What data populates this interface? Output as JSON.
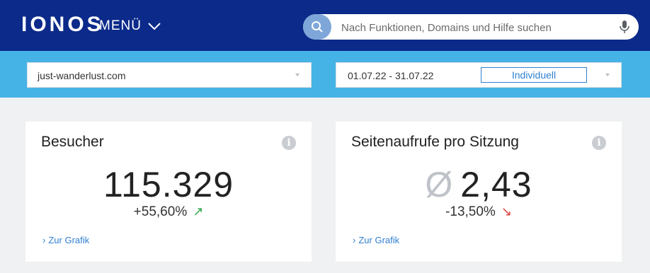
{
  "header": {
    "logo": "IONOS",
    "menu_label": "MENÜ",
    "search_placeholder": "Nach Funktionen, Domains und Hilfe suchen"
  },
  "filters": {
    "domain": "just-wanderlust.com",
    "date_range": "01.07.22 - 31.07.22",
    "range_type": "Individuell"
  },
  "cards": [
    {
      "title": "Besucher",
      "avg_symbol": "",
      "value": "115.329",
      "change": "+55,60%",
      "trend": "up",
      "link": "Zur Grafik"
    },
    {
      "title": "Seitenaufrufe pro Sitzung",
      "avg_symbol": "Ø",
      "value": "2,43",
      "change": "-13,50%",
      "trend": "down",
      "link": "Zur Grafik"
    }
  ],
  "icons": {
    "info": "i",
    "arrow_up": "↗",
    "arrow_down": "↘",
    "chevron": "›"
  },
  "colors": {
    "header_bg": "#0b2a8a",
    "filter_band": "#45b3e6",
    "link": "#2f7fd0",
    "positive": "#2ea84a",
    "negative": "#e0403a"
  }
}
